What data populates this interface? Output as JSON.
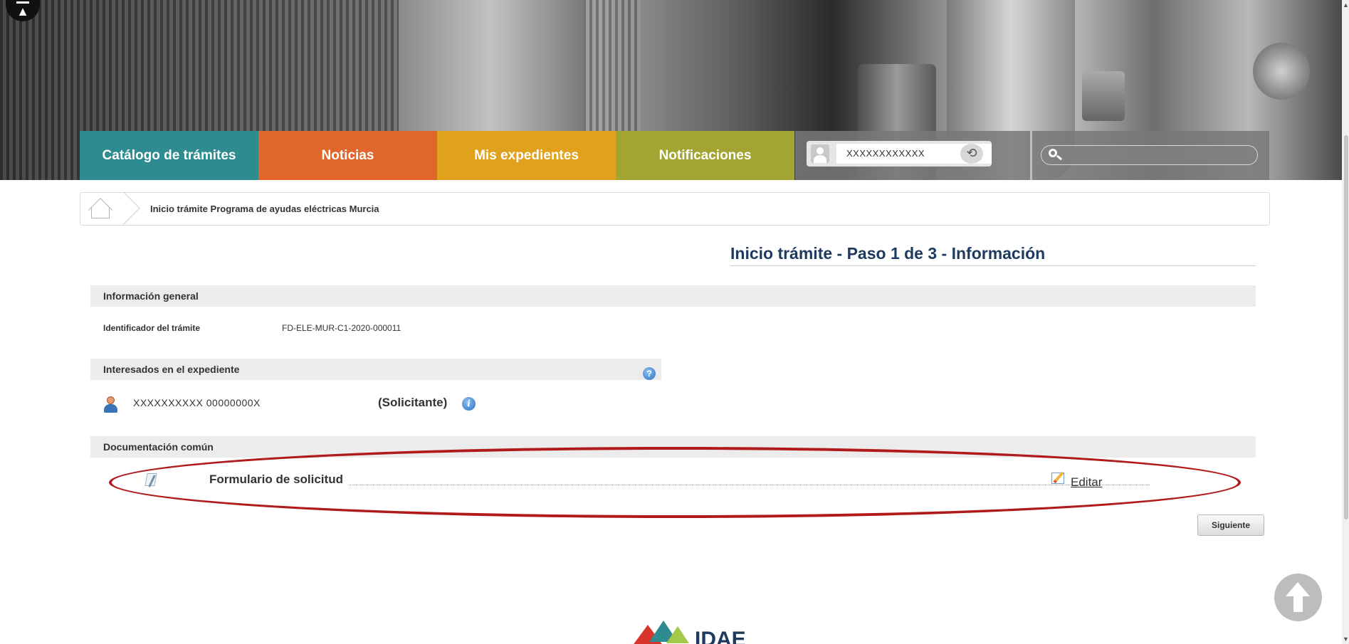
{
  "nav": {
    "tabs": [
      {
        "label": "Catálogo de trámites",
        "color": "#2e8b8f"
      },
      {
        "label": "Noticias",
        "color": "#e1662b"
      },
      {
        "label": "Mis expedientes",
        "color": "#e0a11c"
      },
      {
        "label": "Notificaciones",
        "color": "#a3a533"
      }
    ],
    "user_name": "XXXXXXXXXXXX",
    "search_placeholder": ""
  },
  "breadcrumb": {
    "current": "Inicio trámite Programa de ayudas eléctricas Murcia"
  },
  "main": {
    "title": "Inicio trámite - Paso 1 de 3 - Información",
    "general": {
      "header": "Información general",
      "id_label": "Identificador del trámite",
      "id_value": "FD-ELE-MUR-C1-2020-000011"
    },
    "interesados": {
      "header": "Interesados en el expediente",
      "name": "XXXXXXXXXX 00000000X",
      "role": "(Solicitante)"
    },
    "documentacion": {
      "header": "Documentación común",
      "document_label": "Formulario de solicitud",
      "edit_label": "Editar"
    },
    "next_label": "Siguiente"
  },
  "footer": {
    "logo_text": "IDAE"
  },
  "colors": {
    "highlight": "#b11a1a",
    "title": "#1f3a5f"
  }
}
